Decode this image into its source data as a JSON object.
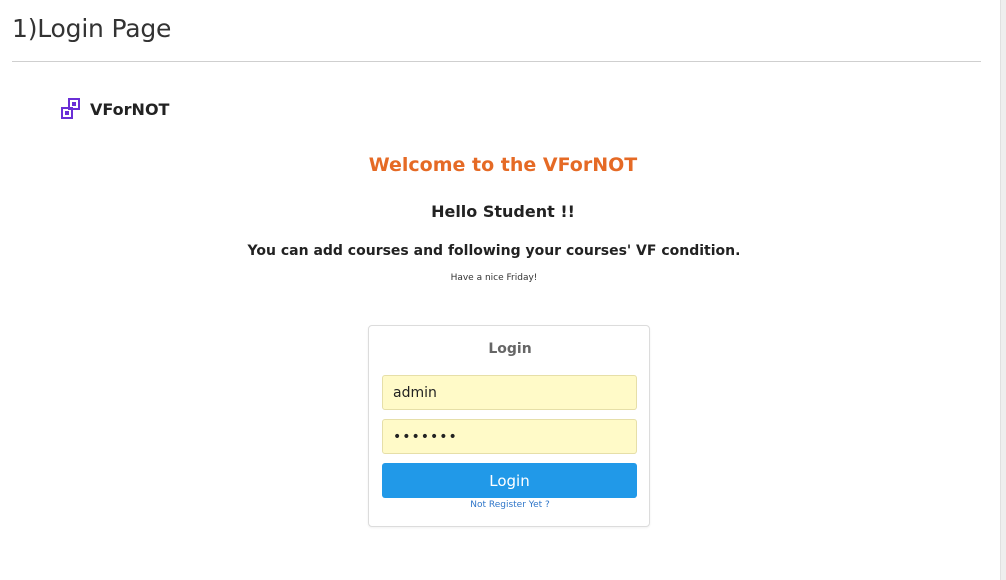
{
  "document": {
    "heading": "1)Login Page"
  },
  "logo": {
    "icon": "squares-logo-icon",
    "text": "VForNOT",
    "color": "#6a2fd6"
  },
  "welcome": {
    "title": "Welcome to the VForNOT",
    "greeting": "Hello Student !!",
    "intro": "You can add courses and following your courses' VF condition.",
    "wish": "Have a nice Friday!"
  },
  "login": {
    "title": "Login",
    "username_value": "admin",
    "password_value": "1234567",
    "button_label": "Login",
    "register_link": "Not Register Yet ?"
  },
  "colors": {
    "accent_orange": "#e56a25",
    "button_blue": "#2199e8",
    "autofill_yellow": "#fffac8",
    "link_blue": "#2f76c9"
  }
}
